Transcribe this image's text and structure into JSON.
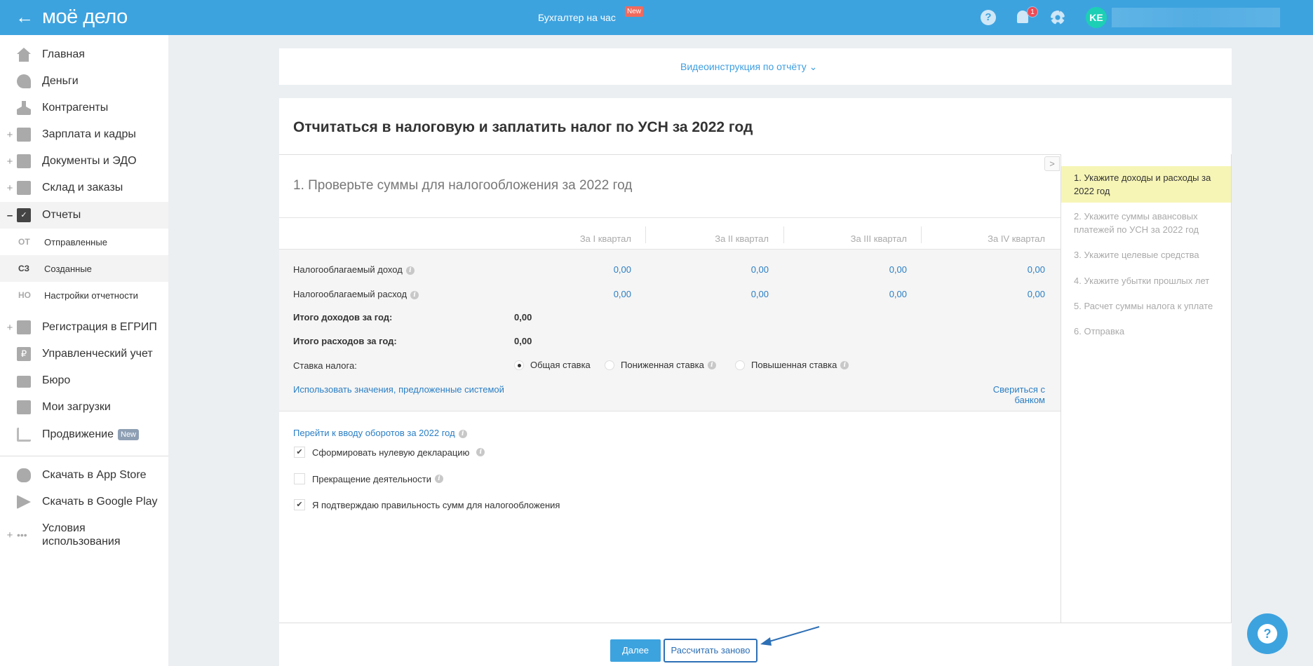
{
  "header": {
    "back_icon": "arrow-left-icon",
    "logo": "моё дело",
    "service_link": "Бухгалтер на час",
    "service_badge": "New",
    "notification_count": "1",
    "avatar_initials": "KE",
    "colors": {
      "bar": "#3da3df",
      "badge": "#f06a5d",
      "avatar": "#1ccfb5"
    }
  },
  "sidebar": {
    "items": [
      {
        "label": "Главная",
        "icon": "home-icon"
      },
      {
        "label": "Деньги",
        "icon": "money-icon"
      },
      {
        "label": "Контрагенты",
        "icon": "contractor-icon"
      },
      {
        "label": "Зарплата и кадры",
        "icon": "wallet-icon",
        "expand": "+"
      },
      {
        "label": "Документы и ЭДО",
        "icon": "folder-icon",
        "expand": "+"
      },
      {
        "label": "Склад и заказы",
        "icon": "warehouse-icon",
        "expand": "+"
      },
      {
        "label": "Отчеты",
        "icon": "report-icon",
        "expand": "–"
      },
      {
        "label": "Регистрация в ЕГРИП",
        "icon": "registration-icon",
        "expand": "+"
      },
      {
        "label": "Управленческий учет",
        "icon": "ruble-icon"
      },
      {
        "label": "Бюро",
        "icon": "briefcase-icon"
      },
      {
        "label": "Мои загрузки",
        "icon": "folder-icon"
      },
      {
        "label": "Продвижение",
        "icon": "chart-icon",
        "badge": "New"
      },
      {
        "label": "Скачать в App Store",
        "icon": "apple-icon"
      },
      {
        "label": "Скачать в Google Play",
        "icon": "google-play-icon"
      },
      {
        "label": "Условия использования",
        "icon": "more-icon",
        "expand": "+"
      }
    ],
    "sub_items": [
      {
        "abbr": "ОТ",
        "label": "Отправленные"
      },
      {
        "abbr": "СЗ",
        "label": "Созданные"
      },
      {
        "abbr": "НО",
        "label": "Настройки отчетности"
      }
    ]
  },
  "video": {
    "label": "Видеоинструкция по отчёту"
  },
  "main": {
    "title": "Отчитаться в налоговую и заплатить налог по УСН за 2022 год",
    "section_title": "1. Проверьте суммы для налогообложения за 2022 год",
    "quarters": [
      "За I квартал",
      "За II квартал",
      "За III квартал",
      "За IV квартал"
    ],
    "rows": [
      {
        "label": "Налогооблагаемый доход",
        "values": [
          "0,00",
          "0,00",
          "0,00",
          "0,00"
        ]
      },
      {
        "label": "Налогооблагаемый расход",
        "values": [
          "0,00",
          "0,00",
          "0,00",
          "0,00"
        ]
      }
    ],
    "total_income_label": "Итого доходов за год:",
    "total_income": "0,00",
    "total_expense_label": "Итого расходов за год:",
    "total_expense": "0,00",
    "rate_label": "Ставка налога:",
    "rates": [
      {
        "label": "Общая ставка",
        "selected": true
      },
      {
        "label": "Пониженная ставка",
        "selected": false
      },
      {
        "label": "Повышенная ставка",
        "selected": false
      }
    ],
    "use_system_values": "Использовать значения, предложенные системой",
    "reconcile_bank": "Свериться с банком",
    "turnover_link": "Перейти к вводу оборотов за 2022 год",
    "checkboxes": [
      {
        "label": "Сформировать нулевую декларацию",
        "checked": true
      },
      {
        "label": "Прекращение деятельности",
        "checked": false
      },
      {
        "label": "Я подтверждаю правильность сумм для налогообложения",
        "checked": true
      }
    ],
    "next_button": "Далее",
    "recalc_button": "Рассчитать заново"
  },
  "steps": [
    "1.  Укажите доходы и расходы за 2022 год",
    "2.  Укажите суммы авансовых платежей по УСН за 2022 год",
    "3.  Укажите целевые средства",
    "4.  Укажите убытки прошлых лет",
    "5.  Расчет суммы налога к уплате",
    "6.  Отправка"
  ]
}
